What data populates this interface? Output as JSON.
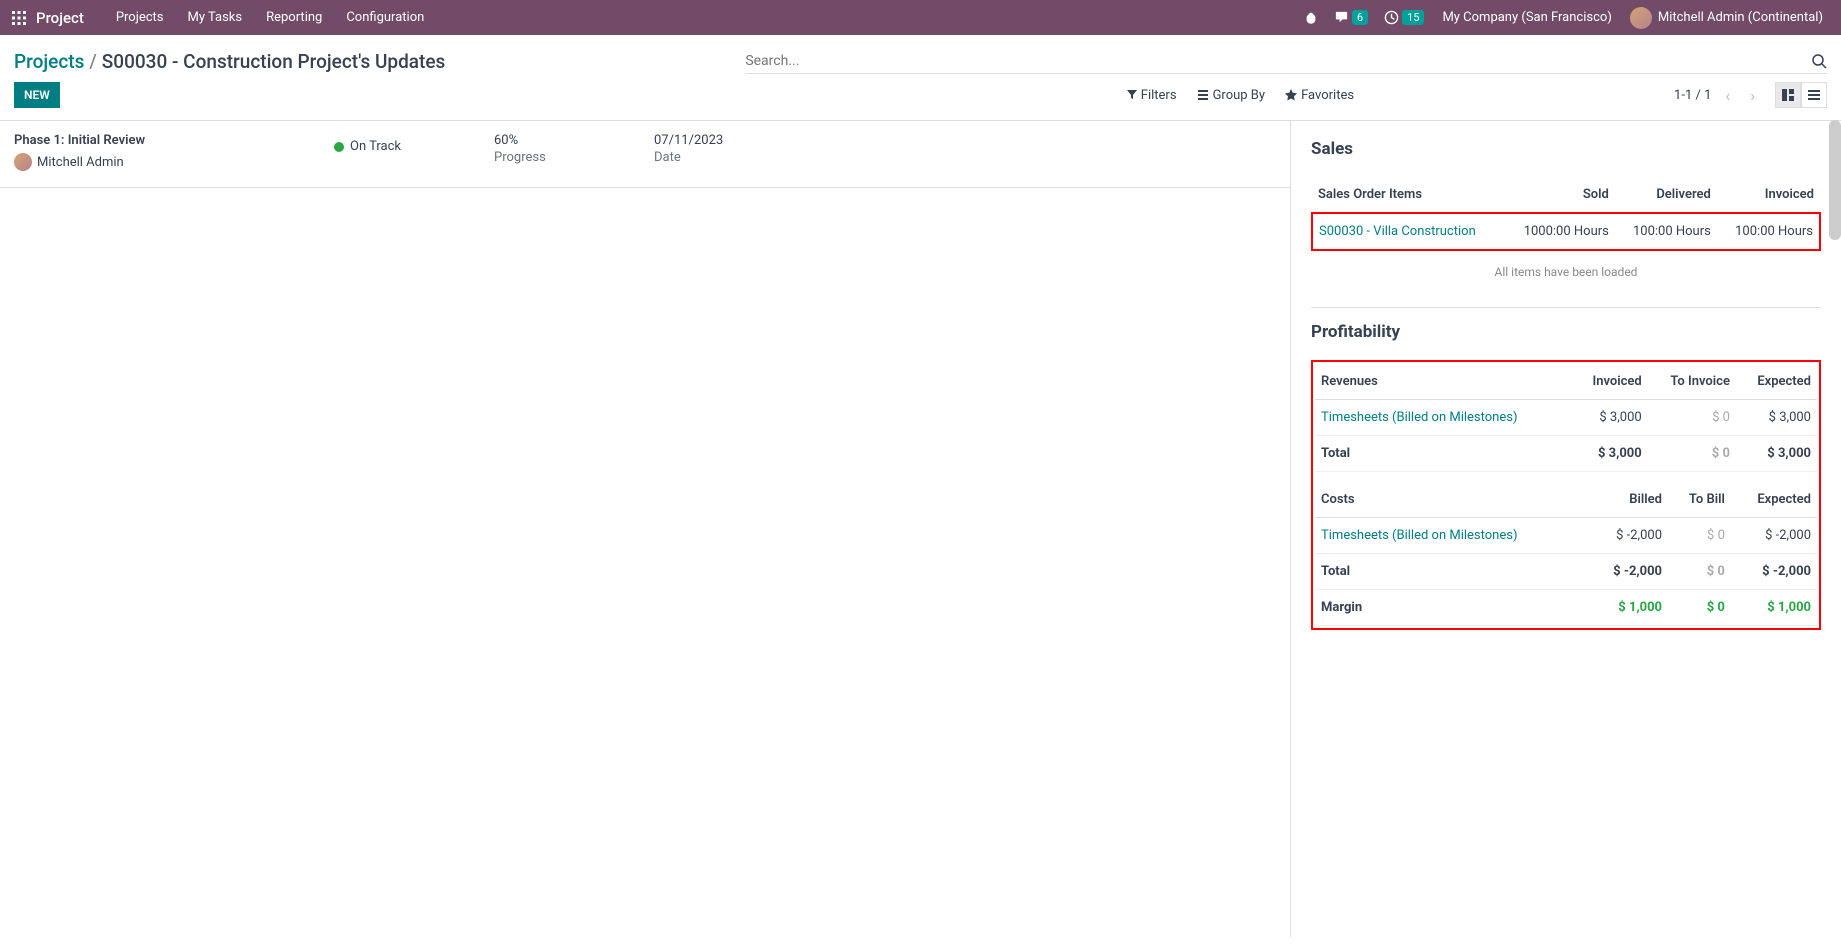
{
  "topbar": {
    "brand": "Project",
    "nav": [
      "Projects",
      "My Tasks",
      "Reporting",
      "Configuration"
    ],
    "messages_badge": "6",
    "activities_badge": "15",
    "company": "My Company (San Francisco)",
    "user": "Mitchell Admin (Continental)"
  },
  "breadcrumb": {
    "root": "Projects",
    "current": "S00030 - Construction Project's Updates"
  },
  "search": {
    "placeholder": "Search..."
  },
  "controls": {
    "new_label": "NEW",
    "filters": "Filters",
    "groupby": "Group By",
    "favorites": "Favorites",
    "pager": "1-1 / 1"
  },
  "row": {
    "phase": "Phase 1: Initial Review",
    "owner": "Mitchell Admin",
    "status": "On Track",
    "progress_value": "60%",
    "progress_label": "Progress",
    "date_value": "07/11/2023",
    "date_label": "Date"
  },
  "sales": {
    "heading": "Sales",
    "headers": [
      "Sales Order Items",
      "Sold",
      "Delivered",
      "Invoiced"
    ],
    "item": {
      "name": "S00030 - Villa Construction",
      "sold": "1000:00 Hours",
      "delivered": "100:00 Hours",
      "invoiced": "100:00 Hours"
    },
    "all_loaded": "All items have been loaded"
  },
  "profitability": {
    "heading": "Profitability",
    "rev_headers": [
      "Revenues",
      "Invoiced",
      "To Invoice",
      "Expected"
    ],
    "rev_row": {
      "name": "Timesheets (Billed on Milestones)",
      "invoiced": "$ 3,000",
      "to_invoice": "$ 0",
      "expected": "$ 3,000"
    },
    "rev_total": {
      "name": "Total",
      "invoiced": "$ 3,000",
      "to_invoice": "$ 0",
      "expected": "$ 3,000"
    },
    "cost_headers": [
      "Costs",
      "Billed",
      "To Bill",
      "Expected"
    ],
    "cost_row": {
      "name": "Timesheets (Billed on Milestones)",
      "billed": "$ -2,000",
      "to_bill": "$ 0",
      "expected": "$ -2,000"
    },
    "cost_total": {
      "name": "Total",
      "billed": "$ -2,000",
      "to_bill": "$ 0",
      "expected": "$ -2,000"
    },
    "margin": {
      "name": "Margin",
      "c1": "$ 1,000",
      "c2": "$ 0",
      "c3": "$ 1,000"
    }
  }
}
